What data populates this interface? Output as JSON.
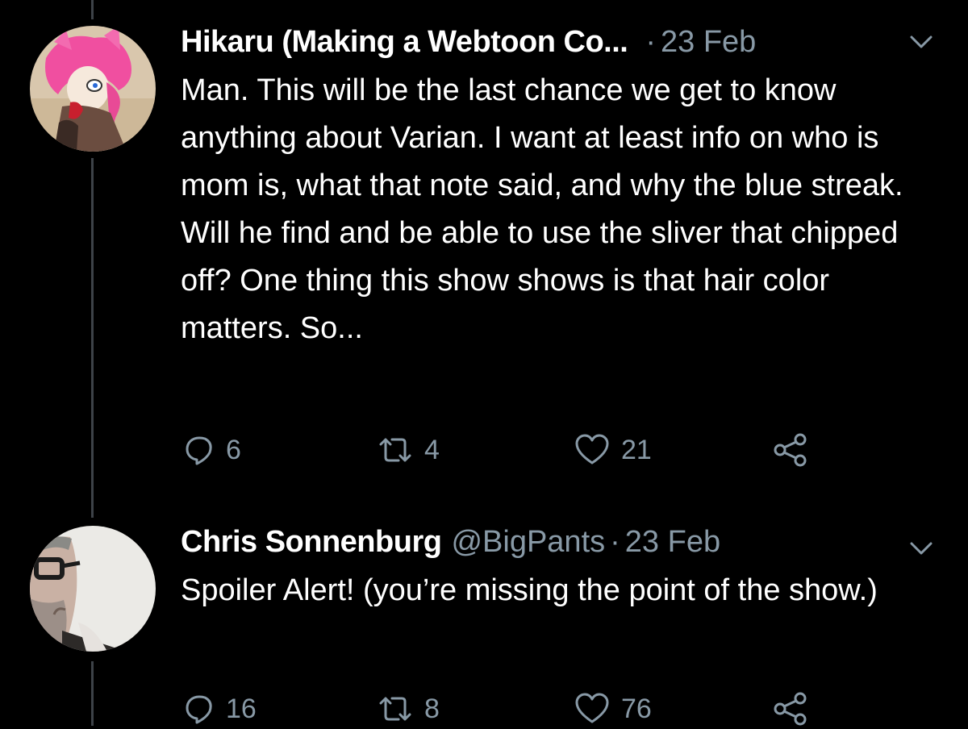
{
  "tweets": [
    {
      "display_name": "Hikaru (Making a Webtoon Co...",
      "handle": "",
      "date": "23 Feb",
      "text": "Man. This will be the last chance we get to know anything about Varian. I want at least info on who is mom is, what that note said, and why the blue streak. Will he find and be able to use the sliver that chipped off? One thing this show shows is that hair color matters. So...",
      "replies": "6",
      "retweets": "4",
      "likes": "21"
    },
    {
      "display_name": "Chris Sonnenburg",
      "handle": "@BigPants",
      "date": "23 Feb",
      "text": "Spoiler Alert! (you’re missing the point of the show.)",
      "replies": "16",
      "retweets": "8",
      "likes": "76"
    }
  ],
  "separator": "·",
  "icons": {
    "reply": "reply-icon",
    "retweet": "retweet-icon",
    "like": "heart-icon",
    "share": "share-icon",
    "more": "chevron-down-icon"
  },
  "colors": {
    "background": "#000000",
    "text": "#ffffff",
    "muted": "#8899a6",
    "thread_line": "#3d4248"
  }
}
